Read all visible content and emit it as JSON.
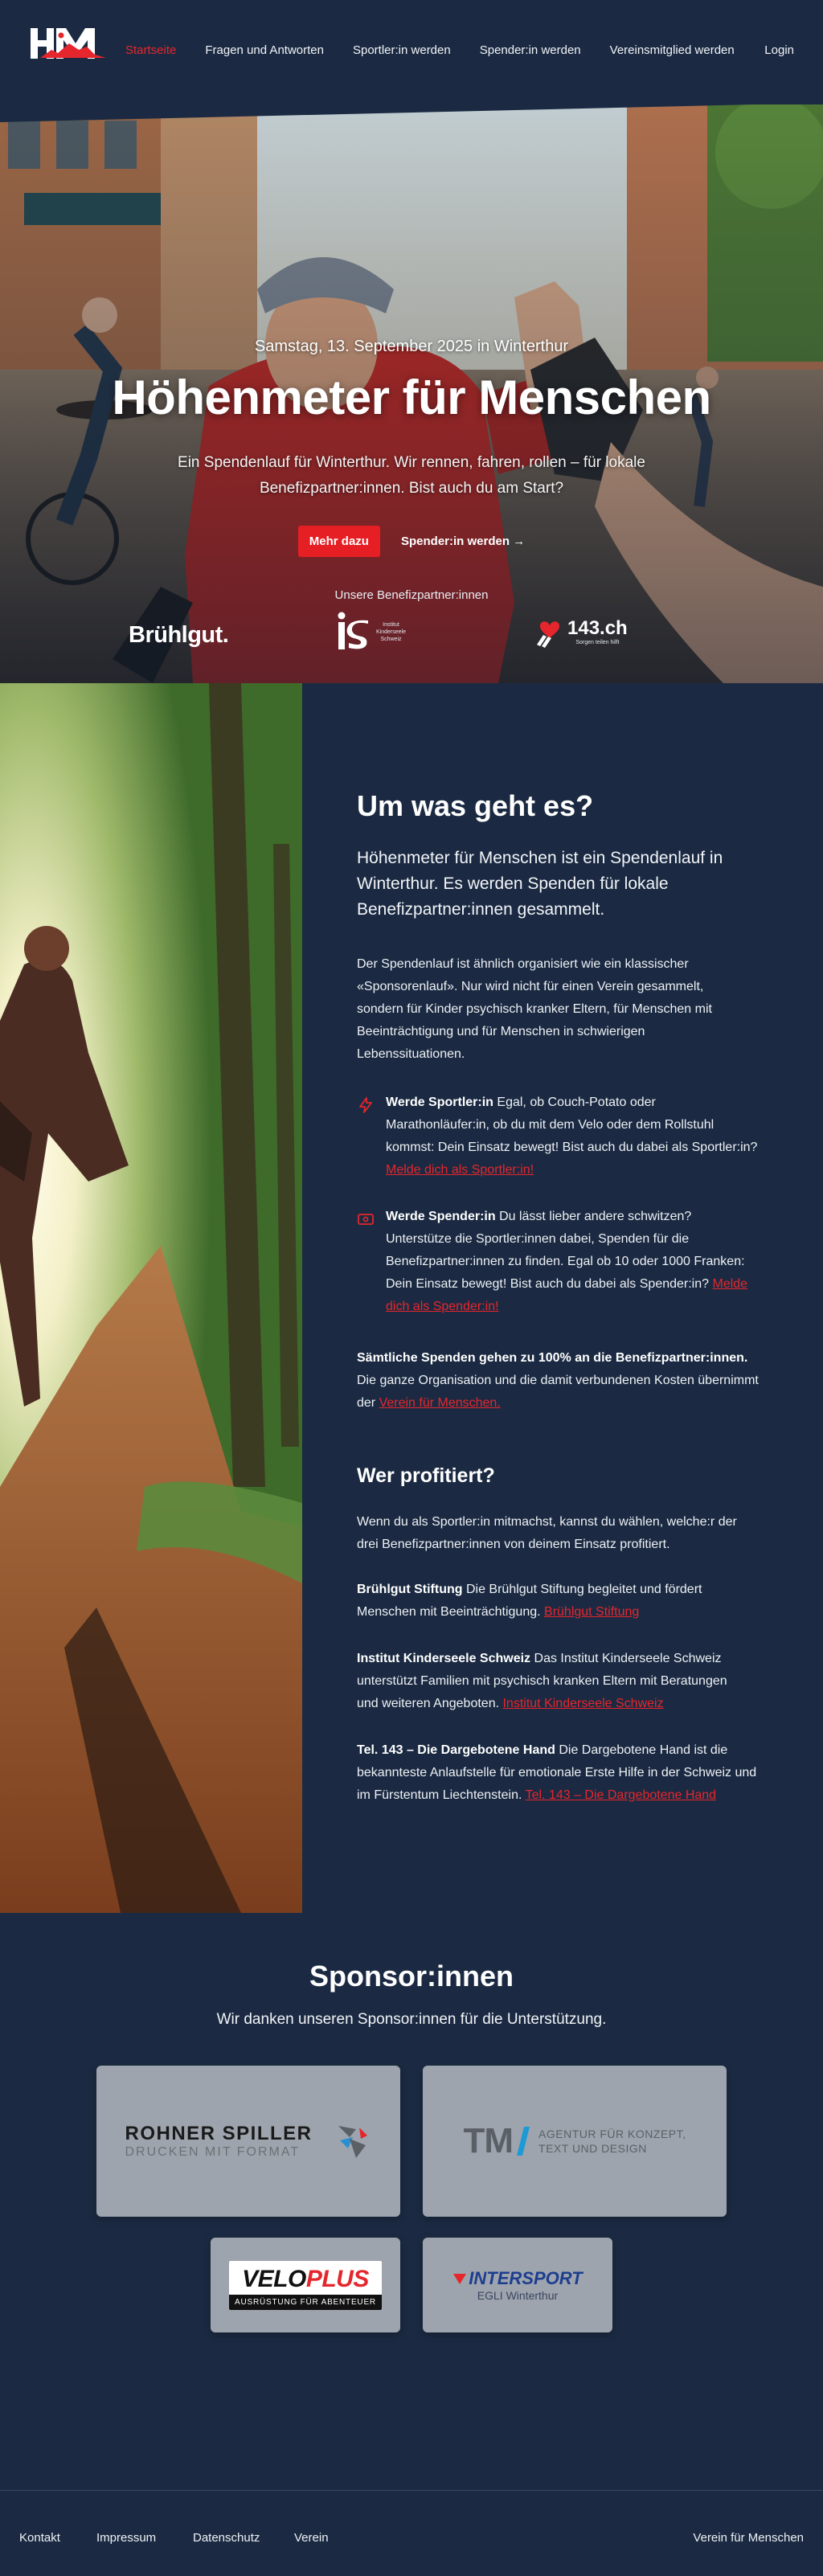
{
  "nav": {
    "logo_text": "HfM",
    "links": [
      "Startseite",
      "Fragen und Antworten",
      "Sportler:in werden",
      "Spender:in werden",
      "Vereinsmitglied werden"
    ],
    "login": "Login",
    "active_color": "#e5262c"
  },
  "hero": {
    "date": "Samstag, 13. September 2025 in Winterthur",
    "title": "Höhenmeter für Menschen",
    "subtitle": "Ein Spendenlauf für Winterthur. Wir rennen, fahren, rollen – für lokale Benefizpartner:innen. Bist auch du am Start?",
    "primary_button": "Mehr dazu",
    "secondary_link": "Spender:in werden →",
    "partners_label": "Unsere Benefizpartner:innen",
    "partner_bruehlgut": "Brühlgut.",
    "partner_is_lines": [
      "Institut",
      "Kinderseele",
      "Schweiz"
    ],
    "partner_143_name": "143.ch",
    "partner_143_tag": "Sorgen teilen hilft"
  },
  "about": {
    "title": "Um was geht es?",
    "lead": "Höhenmeter für Menschen ist ein Spendenlauf in Winterthur. Es werden Spenden für lokale Benefizpartner:innen gesammelt.",
    "intro": "Der Spendenlauf ist ähnlich organisiert wie ein klassischer «Sponsorenlauf». Nur wird nicht für einen Verein gesammelt, sondern für Kinder psychisch kranker Eltern, für Menschen mit Beeinträchtigung und für Menschen in schwierigen Lebenssituationen.",
    "athlete_bold": "Werde Sportler:in",
    "athlete_text": " Egal, ob Couch-Potato oder Marathonläufer:in, ob du mit dem Velo oder dem Rollstuhl kommst: Dein Einsatz bewegt! Bist auch du dabei als Sportler:in? ",
    "athlete_link": "Melde dich als Sportler:in!",
    "donor_bold": "Werde Spender:in",
    "donor_text": " Du lässt lieber andere schwitzen? Unterstütze die Sportler:innen dabei, Spenden für die Benefizpartner:innen zu finden. Egal ob 10 oder 1000 Franken: Dein Einsatz bewegt! Bist auch du dabei als Spender:in? ",
    "donor_link": "Melde dich als Spender:in!",
    "all_bold": "Sämtliche Spenden gehen zu 100% an die Benefizpartner:innen.",
    "all_text": " Die ganze Organisation und die damit verbundenen Kosten übernimmt der ",
    "all_link": "Verein für Menschen."
  },
  "profit": {
    "title": "Wer profitiert?",
    "intro": "Wenn du als Sportler:in mitmachst, kannst du wählen, welche:r der drei Benefizpartner:innen von deinem Einsatz profitiert.",
    "p1_bold": "Brühlgut Stiftung",
    "p1_text": " Die Brühlgut Stiftung begleitet und fördert Menschen mit Beeinträchtigung. ",
    "p1_link": "Brühlgut Stiftung",
    "p2_bold": "Institut Kinderseele Schweiz",
    "p2_text": " Das Institut Kinderseele Schweiz unterstützt Familien mit psychisch kranken Eltern mit Beratungen und weiteren Angeboten. ",
    "p2_link": "Institut Kinderseele Schweiz",
    "p3_bold": "Tel. 143 – Die Dargebotene Hand",
    "p3_text": " Die Dargebotene Hand ist die bekannteste Anlaufstelle für emotionale Erste Hilfe in der Schweiz und im Fürstentum Liechtenstein. ",
    "p3_link": "Tel. 143 – Die Dargebotene Hand"
  },
  "sponsors": {
    "title": "Sponsor:innen",
    "subtitle": "Wir danken unseren Sponsor:innen für die Unterstützung.",
    "rohner_name": "ROHNER SPILLER",
    "rohner_tag": "DRUCKEN MIT FORMAT",
    "tm_name": "TM",
    "tm_tag1": "AGENTUR FÜR KONZEPT,",
    "tm_tag2": "TEXT UND DESIGN",
    "velo_a": "VELO",
    "velo_b": "PLUS",
    "velo_tag": "AUSRÜSTUNG FÜR ABENTEUER",
    "intersport_name": "INTERSPORT",
    "intersport_tag": "EGLI Winterthur"
  },
  "footer": {
    "links": [
      "Kontakt",
      "Impressum",
      "Datenschutz",
      "Verein"
    ],
    "right": "Verein für Menschen"
  },
  "colors": {
    "background": "#1b2a42",
    "accent": "#e5262c",
    "card": "#9ea4ad"
  }
}
